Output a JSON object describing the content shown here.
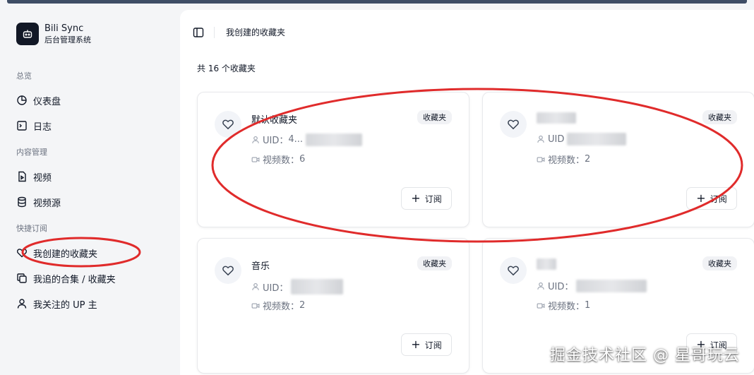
{
  "brand": {
    "title": "Bili Sync",
    "subtitle": "后台管理系统"
  },
  "sidebar": {
    "sections": [
      {
        "label": "总览",
        "items": [
          {
            "label": "仪表盘",
            "icon": "dashboard-icon"
          },
          {
            "label": "日志",
            "icon": "terminal-icon"
          }
        ]
      },
      {
        "label": "内容管理",
        "items": [
          {
            "label": "视频",
            "icon": "video-file-icon"
          },
          {
            "label": "视频源",
            "icon": "database-icon"
          }
        ]
      },
      {
        "label": "快捷订阅",
        "items": [
          {
            "label": "我创建的收藏夹",
            "icon": "heart-icon"
          },
          {
            "label": "我追的合集 / 收藏夹",
            "icon": "copy-icon"
          },
          {
            "label": "我关注的 UP 主",
            "icon": "user-icon"
          }
        ]
      }
    ]
  },
  "header": {
    "title": "我创建的收藏夹"
  },
  "summary": "共 16 个收藏夹",
  "cards": [
    {
      "title": "默认收藏夹",
      "badge": "收藏夹",
      "uid_label": "UID：",
      "uid_value": "4...",
      "video_count_label": "视频数：",
      "video_count": "6",
      "subscribe_label": "订阅"
    },
    {
      "title": "",
      "badge": "收藏夹",
      "uid_label": "UID",
      "uid_value": "",
      "video_count_label": "视频数：",
      "video_count": "2",
      "subscribe_label": "订阅"
    },
    {
      "title": "音乐",
      "badge": "收藏夹",
      "uid_label": "UID：",
      "uid_value": "",
      "video_count_label": "视频数：",
      "video_count": "2",
      "subscribe_label": "订阅"
    },
    {
      "title": "",
      "badge": "收藏夹",
      "uid_label": "UID：",
      "uid_value": "",
      "video_count_label": "视频数：",
      "video_count": "1",
      "subscribe_label": "订阅"
    }
  ],
  "watermark": "掘金技术社区 @ 星哥玩云",
  "colors": {
    "annotation_red": "#e02b2b",
    "brand_dark": "#121826",
    "accent_bar": "#3f4e66"
  }
}
